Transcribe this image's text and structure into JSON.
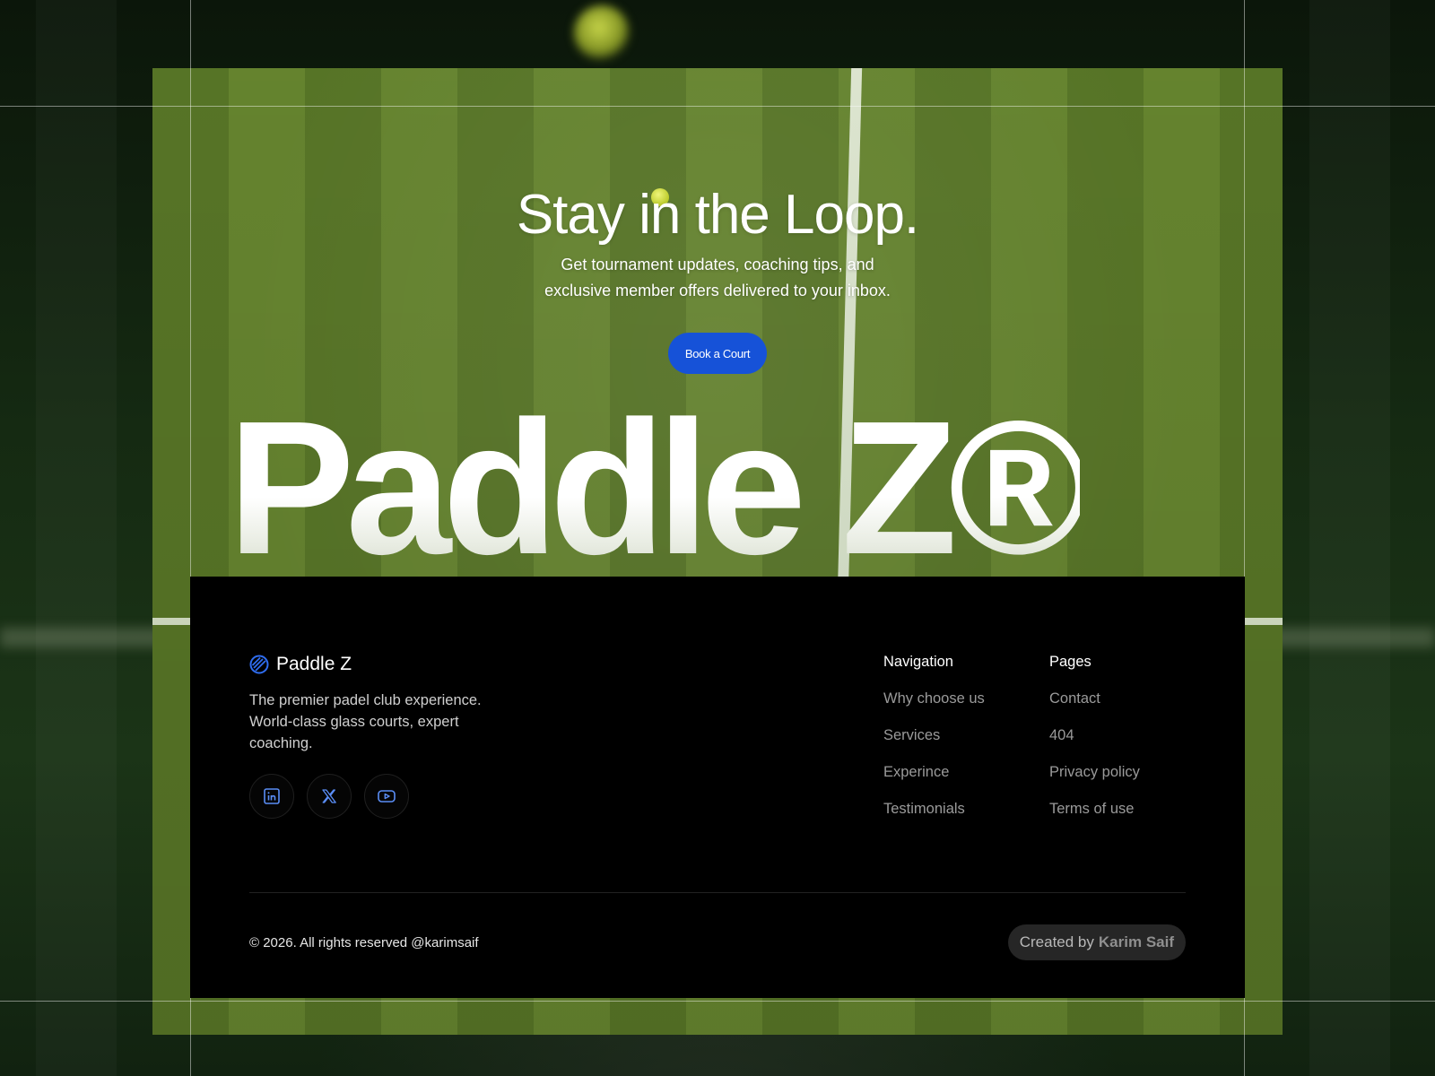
{
  "hero": {
    "title": "Stay in the Loop.",
    "subtitle_line1": "Get tournament updates, coaching tips, and",
    "subtitle_line2": "exclusive member offers delivered to your inbox.",
    "cta_label": "Book a Court",
    "wordmark": "Paddle Z®"
  },
  "footer": {
    "brand_name": "Paddle Z",
    "tagline": "The premier padel club experience. World-class glass courts, expert coaching.",
    "socials": [
      {
        "name": "linkedin-icon"
      },
      {
        "name": "x-twitter-icon"
      },
      {
        "name": "youtube-icon"
      }
    ],
    "navigation": {
      "heading": "Navigation",
      "links": [
        "Why choose us",
        "Services",
        "Experince",
        "Testimonials"
      ]
    },
    "pages": {
      "heading": "Pages",
      "links": [
        "Contact",
        "404",
        "Privacy policy",
        "Terms of use"
      ]
    },
    "copyright": "© 2026. All rights reserved @karimsaif",
    "credit_prefix": "Created by",
    "credit_name": "Karim Saif"
  },
  "colors": {
    "accent": "#1652d8",
    "footer_bg": "#000000",
    "court_green": "#5b7a28"
  }
}
